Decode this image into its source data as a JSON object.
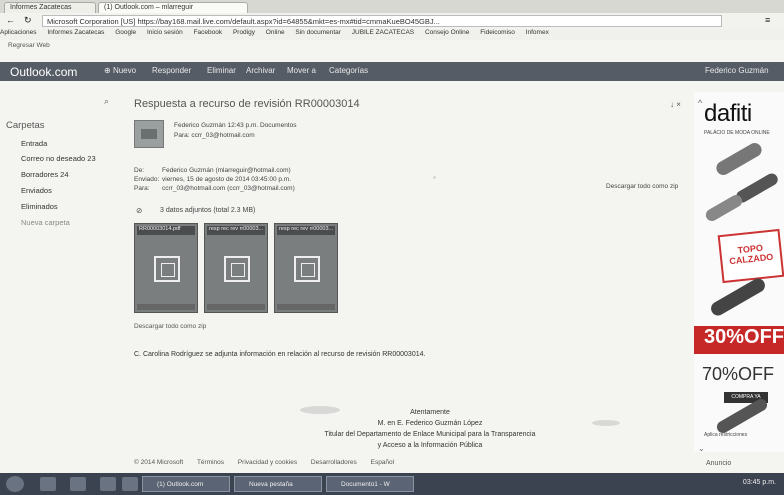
{
  "browser": {
    "tabs": [
      {
        "label": "Informes Zacatecas"
      },
      {
        "label": "(1) Outlook.com – mlarreguir"
      }
    ],
    "url": "Microsoft Corporation [US] https://bay168.mail.live.com/default.aspx?id=64855&mkt=es-mx#tid=cmmaKueBO45GBJ...",
    "bookmarks": [
      "Aplicaciones",
      "Informes Zacatecas",
      "Google",
      "Inicio sesión",
      "Facebook",
      "Prodigy",
      "Online",
      "Sin documentar",
      "JUBILE ZACATECAS",
      "Consejo Online",
      "Fideicomiso",
      "Infomex"
    ],
    "small_toolbar": "Regresar  Web"
  },
  "header": {
    "logo": "Outlook.com",
    "new": "Nuevo",
    "reply": "Responder",
    "delete": "Eliminar",
    "archive": "Archivar",
    "move": "Mover a",
    "categories": "Categorías",
    "user": "Federico Guzmán"
  },
  "folders": {
    "title": "Carpetas",
    "items": [
      "Entrada",
      "Correo no deseado  23",
      "Borradores  24",
      "Enviados",
      "Eliminados",
      "Nueva carpeta"
    ]
  },
  "message": {
    "subject": "Respuesta a recurso de revisión RR00003014",
    "sender_line": "Federico Guzmán  12:43 p.m.  Documentos",
    "to_line": "Para: ccrr_03@hotmail.com",
    "de_label": "De:",
    "de_value": "Federico Guzmán (mlarreguir@hotmail.com)",
    "sent_label": "Enviado:",
    "sent_value": "viernes, 15 de agosto de 2014 03:45:00 p.m.",
    "para_label": "Para:",
    "para_value": "ccrr_03@hotmail.com (ccrr_03@hotmail.com)",
    "attachments_summary": "3 datos adjuntos (total 2.3 MB)",
    "attachments": [
      {
        "name": "RR00003014.pdf"
      },
      {
        "name": "resp rec rev rr00003..."
      },
      {
        "name": "resp rec rev rr00003..."
      }
    ],
    "download_all": "Descargar todo como zip",
    "download_all_right": "Descargar todo como zip",
    "body": "C. Carolina Rodríguez se adjunta información en relación al recurso de revisión RR00003014.",
    "signature": [
      "Atentamente",
      "M. en E. Federico Guzmán López",
      "Titular del Departamento de Enlace Municipal para la Transparencia",
      "y Acceso a la Información Pública"
    ]
  },
  "footer": [
    "© 2014 Microsoft",
    "Términos",
    "Privacidad y cookies",
    "Desarrolladores",
    "Español"
  ],
  "ad": {
    "logo": "dafiti",
    "sub": "PALÁCIO DE MODA ONLINE",
    "tag": "TOPO CALZADO",
    "discount1": "30%OFF",
    "discount2": "70%OFF",
    "cta": "COMPRA YA",
    "fine": "Aplica restricciones"
  },
  "anuncio": "Anuncio",
  "taskbar": {
    "apps": [
      "(1) Outlook.com",
      "Nueva pestaña",
      "Documento1 - W"
    ],
    "clock": "03:45 p.m."
  }
}
